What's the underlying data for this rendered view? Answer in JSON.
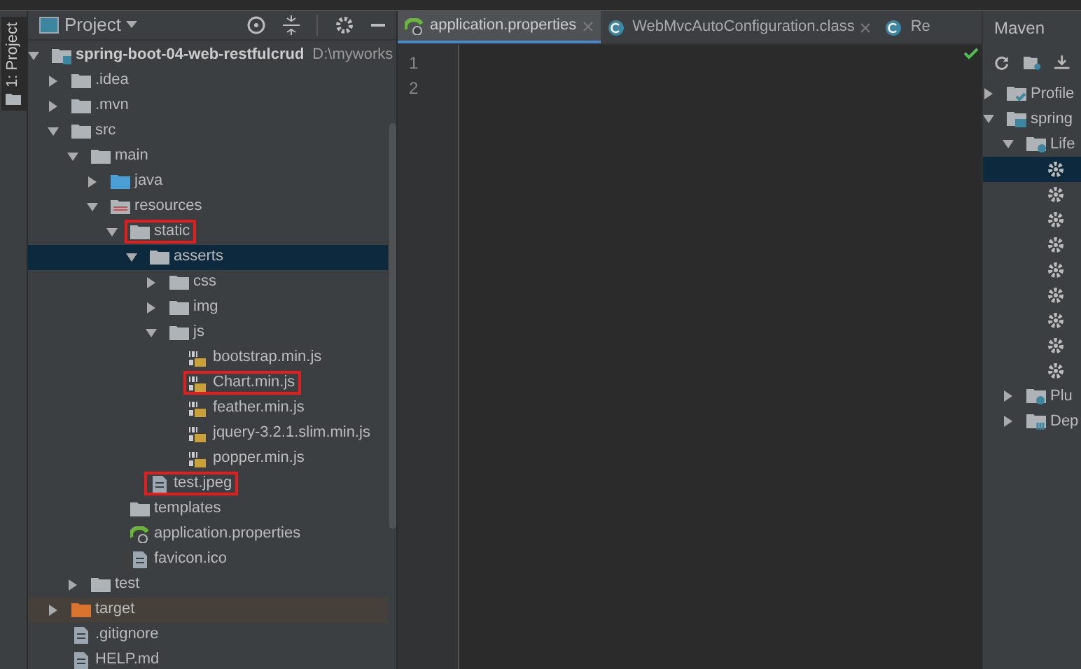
{
  "side_tab": {
    "label": "1: Project"
  },
  "project_panel": {
    "title": "Project",
    "tree": [
      {
        "label": "spring-boot-04-web-restfulcrud",
        "kind": "module",
        "expanded": true,
        "selected": false,
        "highlighted": false,
        "path": "D:\\myworks",
        "children": [
          {
            "label": ".idea",
            "kind": "folder",
            "expanded": false,
            "selected": false,
            "highlighted": false
          },
          {
            "label": ".mvn",
            "kind": "folder",
            "expanded": false,
            "selected": false,
            "highlighted": false
          },
          {
            "label": "src",
            "kind": "folder",
            "expanded": true,
            "selected": false,
            "highlighted": false,
            "children": [
              {
                "label": "main",
                "kind": "folder",
                "expanded": true,
                "selected": false,
                "highlighted": false,
                "children": [
                  {
                    "label": "java",
                    "kind": "source",
                    "expanded": false,
                    "selected": false,
                    "highlighted": false
                  },
                  {
                    "label": "resources",
                    "kind": "resources",
                    "expanded": true,
                    "selected": false,
                    "highlighted": false,
                    "children": [
                      {
                        "label": "static",
                        "kind": "folder",
                        "expanded": true,
                        "selected": false,
                        "highlighted": true,
                        "children": [
                          {
                            "label": "asserts",
                            "kind": "folder",
                            "expanded": true,
                            "selected": true,
                            "highlighted": false,
                            "children": [
                              {
                                "label": "css",
                                "kind": "folder",
                                "expanded": false,
                                "selected": false,
                                "highlighted": false
                              },
                              {
                                "label": "img",
                                "kind": "folder",
                                "expanded": false,
                                "selected": false,
                                "highlighted": false
                              },
                              {
                                "label": "js",
                                "kind": "folder",
                                "expanded": true,
                                "selected": false,
                                "highlighted": false,
                                "children": [
                                  {
                                    "label": "bootstrap.min.js",
                                    "kind": "js",
                                    "selected": false,
                                    "highlighted": false
                                  },
                                  {
                                    "label": "Chart.min.js",
                                    "kind": "js",
                                    "selected": false,
                                    "highlighted": true
                                  },
                                  {
                                    "label": "feather.min.js",
                                    "kind": "js",
                                    "selected": false,
                                    "highlighted": false
                                  },
                                  {
                                    "label": "jquery-3.2.1.slim.min.js",
                                    "kind": "js",
                                    "selected": false,
                                    "highlighted": false
                                  },
                                  {
                                    "label": "popper.min.js",
                                    "kind": "js",
                                    "selected": false,
                                    "highlighted": false
                                  }
                                ]
                              }
                            ]
                          },
                          {
                            "label": "test.jpeg",
                            "kind": "file",
                            "selected": false,
                            "highlighted": true
                          }
                        ]
                      },
                      {
                        "label": "templates",
                        "kind": "folder",
                        "selected": false,
                        "highlighted": false
                      },
                      {
                        "label": "application.properties",
                        "kind": "properties",
                        "selected": false,
                        "highlighted": false
                      },
                      {
                        "label": "favicon.ico",
                        "kind": "file",
                        "selected": false,
                        "highlighted": false
                      }
                    ]
                  }
                ]
              },
              {
                "label": "test",
                "kind": "folder",
                "expanded": false,
                "selected": false,
                "highlighted": false
              }
            ]
          },
          {
            "label": "target",
            "kind": "excluded",
            "expanded": false,
            "selected": false,
            "highlighted": false
          },
          {
            "label": ".gitignore",
            "kind": "file",
            "selected": false,
            "highlighted": false
          },
          {
            "label": "HELP.md",
            "kind": "file",
            "selected": false,
            "highlighted": false
          }
        ]
      }
    ]
  },
  "editor": {
    "tabs": [
      {
        "label": "application.properties",
        "kind": "properties",
        "selected": true
      },
      {
        "label": "WebMvcAutoConfiguration.class",
        "kind": "class",
        "selected": false
      },
      {
        "label": "Re",
        "kind": "class",
        "selected": false
      }
    ],
    "line_numbers": [
      "1",
      "2"
    ]
  },
  "maven_panel": {
    "title": "Maven",
    "tree": [
      {
        "label": "Profile",
        "kind": "profiles",
        "expanded": false,
        "selected": false
      },
      {
        "label": "spring",
        "kind": "project",
        "expanded": true,
        "selected": false,
        "children": [
          {
            "label": "Life",
            "kind": "lifecycle",
            "expanded": true,
            "selected": false,
            "children": [
              {
                "kind": "goal",
                "selected": true
              },
              {
                "kind": "goal",
                "selected": false
              },
              {
                "kind": "goal",
                "selected": false
              },
              {
                "kind": "goal",
                "selected": false
              },
              {
                "kind": "goal",
                "selected": false
              },
              {
                "kind": "goal",
                "selected": false
              },
              {
                "kind": "goal",
                "selected": false
              },
              {
                "kind": "goal",
                "selected": false
              },
              {
                "kind": "goal",
                "selected": false
              }
            ]
          },
          {
            "label": "Plu",
            "kind": "plugins",
            "expanded": false,
            "selected": false
          },
          {
            "label": "Dep",
            "kind": "deps",
            "expanded": false,
            "selected": false
          }
        ]
      }
    ]
  }
}
